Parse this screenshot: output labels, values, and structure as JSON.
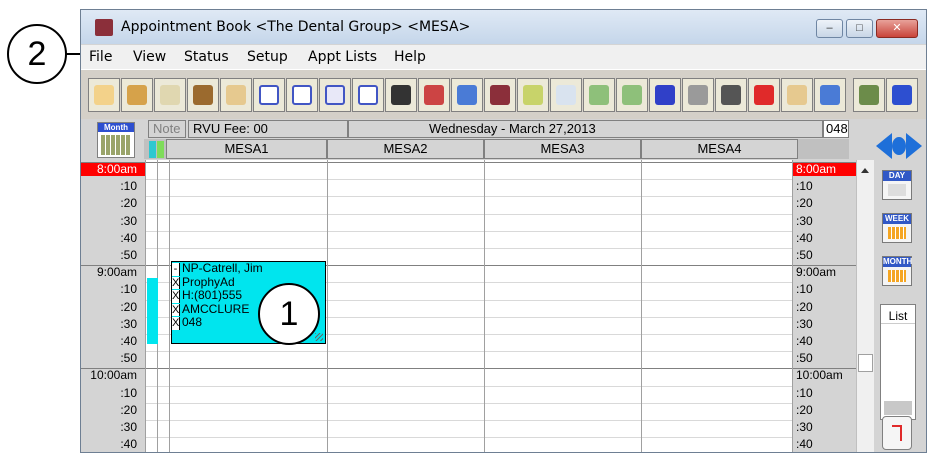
{
  "window": {
    "title": "Appointment Book <The Dental Group> <MESA>",
    "controls": [
      "–",
      "□",
      "✕"
    ]
  },
  "menu": [
    "File",
    "View",
    "Status",
    "Setup",
    "Appt Lists",
    "Help"
  ],
  "toolbar": {
    "icons": [
      "tooth-icon",
      "folder-icon",
      "notes-icon",
      "chair-icon",
      "signature-icon",
      "blank-form-icon",
      "form-icon",
      "recall-icon",
      "email-icon",
      "calculator-icon",
      "prescription-icon",
      "refresh-icon",
      "book-icon",
      "chart-icon",
      "search-icon",
      "xray-icon",
      "appt-icon",
      "checkmark-icon",
      "printer-icon",
      "trash-icon",
      "medical-alert-icon",
      "patient-icon",
      "schedule-icon",
      "grid-icon",
      "forward-icon"
    ]
  },
  "header": {
    "month_button": "Month",
    "note_label": "Note",
    "rvu_fee": "RVU Fee: 00",
    "date": "Wednesday - March 27,2013",
    "operator_code": "048",
    "columns": [
      "MESA1",
      "MESA2",
      "MESA3",
      "MESA4"
    ]
  },
  "time_slots": [
    {
      "label": "8:00am",
      "highlight": true
    },
    {
      "label": ":10"
    },
    {
      "label": ":20"
    },
    {
      "label": ":30"
    },
    {
      "label": ":40"
    },
    {
      "label": ":50"
    },
    {
      "label": "9:00am"
    },
    {
      "label": ":10"
    },
    {
      "label": ":20"
    },
    {
      "label": ":30"
    },
    {
      "label": ":40"
    },
    {
      "label": ":50"
    },
    {
      "label": "10:00am"
    },
    {
      "label": ":10"
    },
    {
      "label": ":20"
    },
    {
      "label": ":30"
    },
    {
      "label": ":40"
    }
  ],
  "appointment": {
    "lines": [
      {
        "check": "-",
        "text": "NP-Catrell, Jim"
      },
      {
        "check": "X",
        "text": "ProphyAd"
      },
      {
        "check": "X",
        "text": "H:(801)555"
      },
      {
        "check": "X",
        "text": "AMCCLURE"
      },
      {
        "check": "X",
        "text": "048"
      }
    ]
  },
  "right_panel": {
    "day": "DAY",
    "week": "WEEK",
    "month": "MONTH",
    "list": "List"
  },
  "callouts": {
    "one": "1",
    "two": "2"
  },
  "colors": {
    "appointment_bg": "#00e5ee",
    "time_highlight": "#ff0000",
    "nav_blue": "#1e6fd9"
  }
}
